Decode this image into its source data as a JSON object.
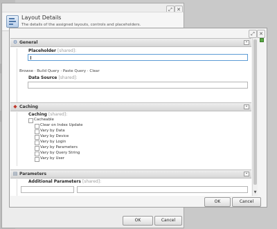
{
  "outer_dialog": {
    "title": "Layout Details",
    "subtitle": "The details of the assigned layouts, controls and placeholders.",
    "ok_label": "OK",
    "cancel_label": "Cancel"
  },
  "inner_dialog": {
    "ok_label": "OK",
    "cancel_label": "Cancel",
    "general": {
      "header": "General",
      "placeholder_label": "Placeholder",
      "placeholder_shared": "[shared]:",
      "placeholder_value": "",
      "actions": [
        "Browse",
        "Build Query",
        "Paste Query",
        "Clear"
      ],
      "action_sep": "·",
      "data_source_label": "Data Source",
      "data_source_shared": "[shared]:",
      "data_source_value": ""
    },
    "caching": {
      "header": "Caching",
      "caching_label": "Caching",
      "caching_shared": "[shared]:",
      "cacheable_label": "Cacheable",
      "options": [
        "Clear on Index Update",
        "Vary by Data",
        "Vary by Device",
        "Vary by Login",
        "Vary by Parameters",
        "Vary by Query String",
        "Vary by User"
      ]
    },
    "parameters": {
      "header": "Parameters",
      "additional_label": "Additional Parameters",
      "additional_shared": "[shared]:"
    }
  },
  "colors": {
    "focus_border": "#5b9bd5",
    "scrollbar_thumb": "#c6c6c6"
  }
}
